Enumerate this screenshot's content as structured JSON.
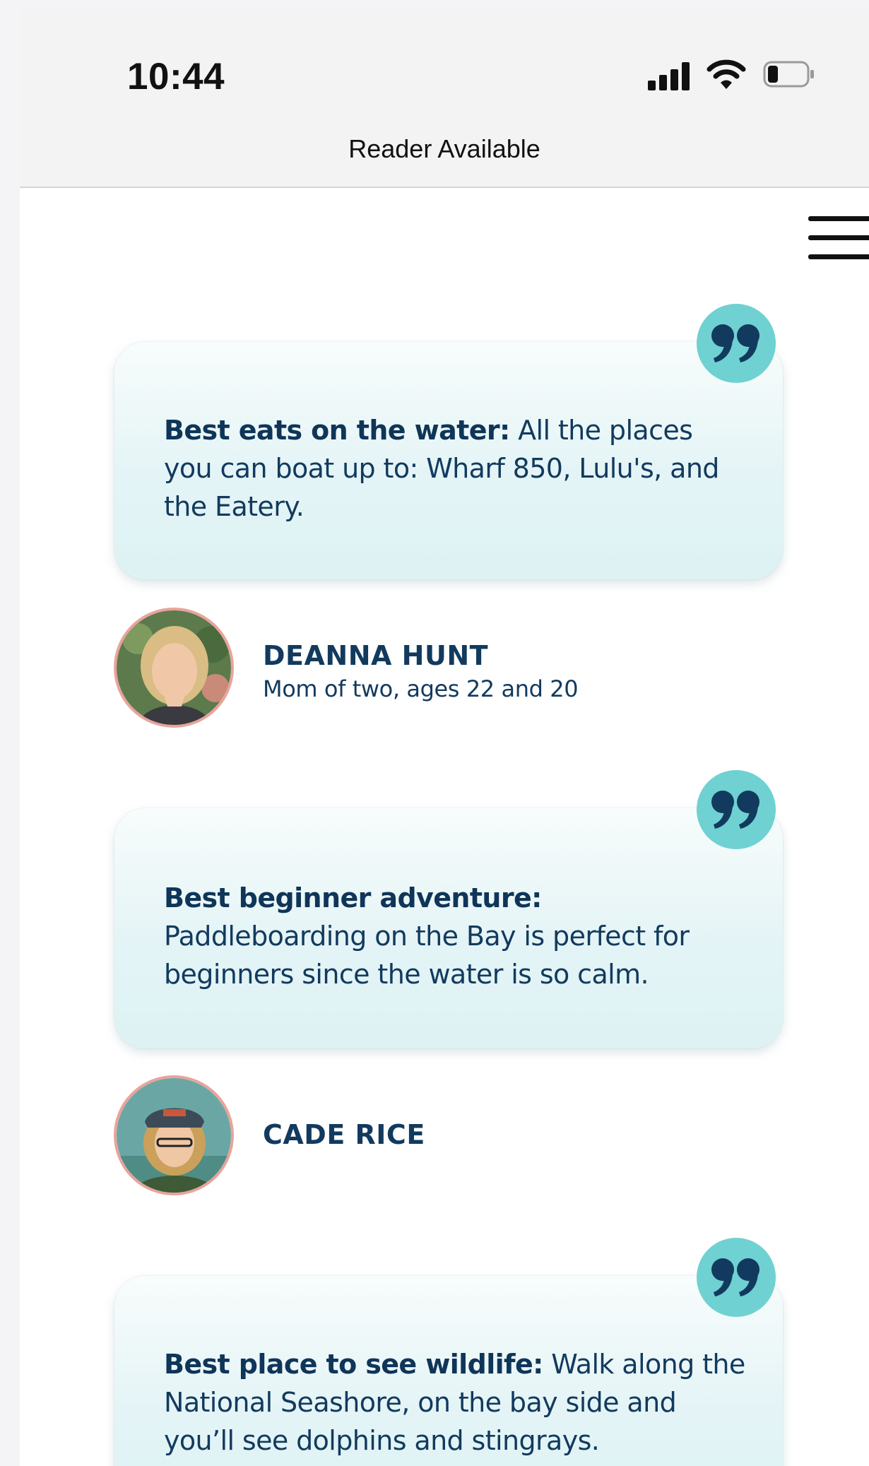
{
  "status_bar": {
    "time": "10:44",
    "reader_label": "Reader Available"
  },
  "icons": {
    "signal": "cellular-signal-icon",
    "wifi": "wifi-icon",
    "battery": "battery-low-icon",
    "menu": "hamburger-menu-icon",
    "quote": "quote-mark-icon"
  },
  "colors": {
    "accent": "#6fd1d1",
    "text": "#123a5e",
    "avatar_ring": "#e9a39c"
  },
  "quotes": [
    {
      "heading": "Best eats on the water:",
      "body": " All the places you can boat up to: Wharf 850, Lulu's, and the Eatery."
    },
    {
      "heading": "Best beginner adventure:",
      "body": " Paddleboarding on the Bay is perfect for beginners since the water is so calm."
    },
    {
      "heading": "Best place to see wildlife:",
      "body": " Walk along the National Seashore, on the bay side and you’ll see dolphins and stingrays."
    }
  ],
  "people": [
    {
      "name": "DEANNA HUNT",
      "subtitle": "Mom of two, ages 22 and 20"
    },
    {
      "name": "CADE RICE",
      "subtitle": ""
    }
  ]
}
